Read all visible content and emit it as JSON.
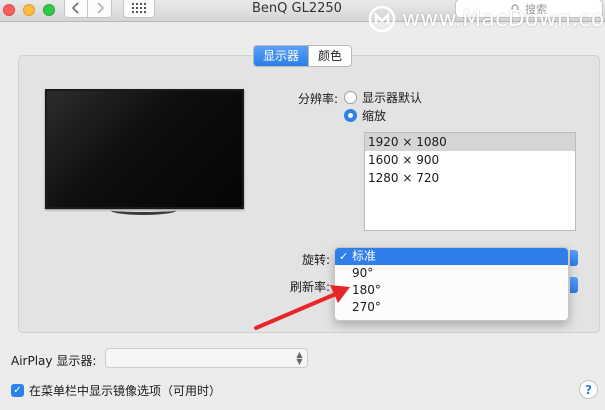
{
  "window": {
    "title": "BenQ GL2250",
    "search_placeholder": "搜索",
    "watermark_text": "www.MacDown.com"
  },
  "toolbar": {
    "back_icon": "chevron-left-icon",
    "forward_icon": "chevron-right-icon",
    "grid_icon": "grid-icon",
    "search_icon": "magnifier-icon"
  },
  "tabs": [
    {
      "label": "显示器",
      "active": true
    },
    {
      "label": "颜色",
      "active": false
    }
  ],
  "resolution": {
    "label": "分辨率:",
    "options": [
      {
        "label": "显示器默认",
        "selected": false
      },
      {
        "label": "缩放",
        "selected": true
      }
    ],
    "list": [
      "1920 × 1080",
      "1600 × 900",
      "1280 × 720"
    ],
    "selected_index": 0
  },
  "rotation": {
    "label": "旋转:",
    "menu": [
      {
        "label": "标准",
        "checked": true,
        "highlighted": true
      },
      {
        "label": "90°",
        "checked": false,
        "highlighted": false
      },
      {
        "label": "180°",
        "checked": false,
        "highlighted": false
      },
      {
        "label": "270°",
        "checked": false,
        "highlighted": false
      }
    ]
  },
  "refresh": {
    "label": "刷新率:"
  },
  "airplay": {
    "label": "AirPlay 显示器:",
    "value": ""
  },
  "mirror_option": {
    "label": "在菜单栏中显示镜像选项（可用时）",
    "checked": true
  },
  "help": {
    "label": "?"
  },
  "colors": {
    "accent": "#2f7ee9",
    "annotation_arrow": "#e8262a"
  }
}
